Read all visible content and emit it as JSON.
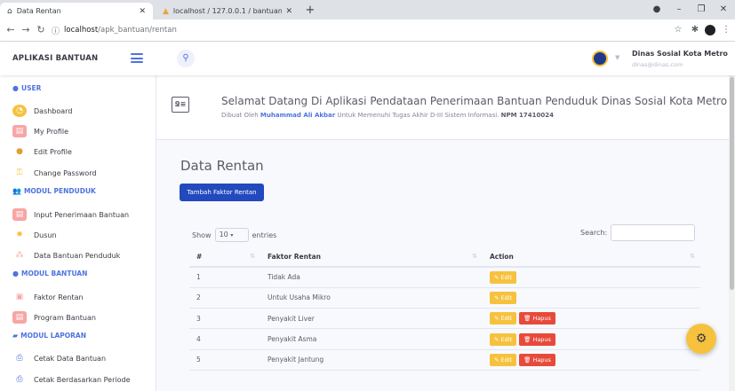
{
  "browser": {
    "tabs": [
      {
        "title": "Data Rentan",
        "icon": "home-icon",
        "active": true
      },
      {
        "title": "localhost / 127.0.0.1 / bantuan / ",
        "icon": "phpmyadmin-icon",
        "active": false
      }
    ],
    "url_host": "localhost",
    "url_path": "/apk_bantuan/rentan"
  },
  "topbar": {
    "brand": "APLIKASI BANTUAN",
    "user_name": "Dinas Sosial Kota Metro",
    "user_email": "dinas@dinas.com"
  },
  "sidebar": {
    "sections": [
      {
        "heading": "USER",
        "icon": "circle-icon",
        "items": [
          "Dashboard",
          "My Profile",
          "Edit Profile",
          "Change Password"
        ]
      },
      {
        "heading": "MODUL PENDUDUK",
        "icon": "users-icon",
        "items": [
          "Input Penerimaan Bantuan",
          "Dusun",
          "Data Bantuan Penduduk"
        ]
      },
      {
        "heading": "MODUL BANTUAN",
        "icon": "circle-icon",
        "items": [
          "Faktor Rentan",
          "Program Bantuan"
        ]
      },
      {
        "heading": "MODUL LAPORAN",
        "icon": "book-icon",
        "items": [
          "Cetak Data Bantuan",
          "Cetak Berdasarkan Periode"
        ]
      }
    ]
  },
  "welcome": {
    "title": "Selamat Datang Di Aplikasi Pendataan Penerimaan Bantuan Penduduk Dinas Sosial Kota Metro",
    "sub_prefix": "Dibuat Oleh",
    "author": "Muhammad Ali Akbar",
    "sub_middle": "Untuk Memenuhi Tugas Akhir D-III Sistem Informasi.",
    "npm": "NPM 17410024"
  },
  "page": {
    "title": "Data Rentan",
    "add_button": "Tambah Faktor Rentan",
    "show_label": "Show",
    "entries_value": "10",
    "entries_label": "entries",
    "search_label": "Search:"
  },
  "table": {
    "headers": [
      "#",
      "Faktor Rentan",
      "Action"
    ],
    "rows": [
      {
        "num": "1",
        "faktor": "Tidak Ada",
        "edit": "Edit",
        "hapus": null
      },
      {
        "num": "2",
        "faktor": "Untuk Usaha Mikro",
        "edit": "Edit",
        "hapus": null
      },
      {
        "num": "3",
        "faktor": "Penyakit Liver",
        "edit": "Edit",
        "hapus": "Hapus"
      },
      {
        "num": "4",
        "faktor": "Penyakit Asma",
        "edit": "Edit",
        "hapus": "Hapus"
      },
      {
        "num": "5",
        "faktor": "Penyakit Jantung",
        "edit": "Edit",
        "hapus": "Hapus"
      }
    ]
  },
  "colors": {
    "primary": "#4e73df",
    "primary_dark": "#224abe",
    "warning": "#f6c23e",
    "danger": "#e74a3b"
  }
}
